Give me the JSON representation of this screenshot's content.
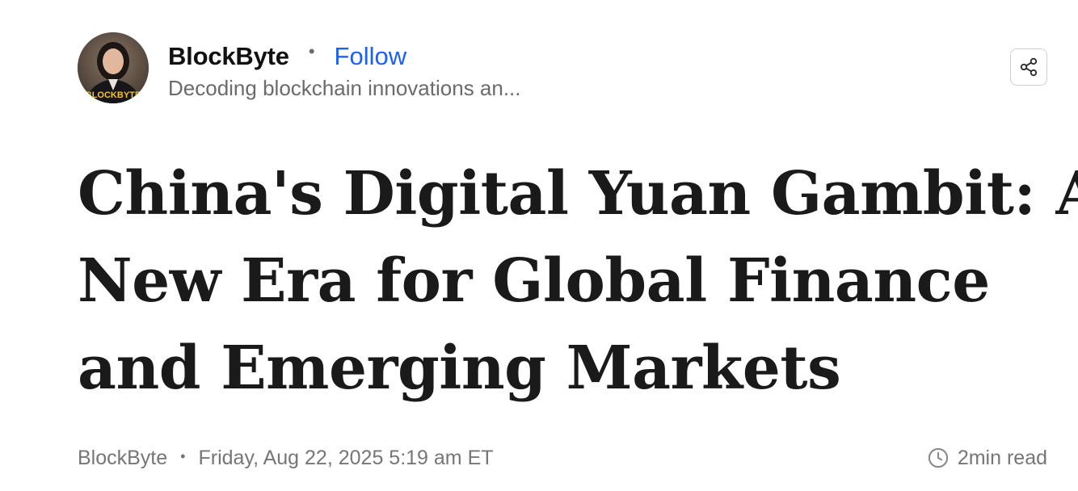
{
  "author": {
    "name": "BlockByte",
    "follow_label": "Follow",
    "tagline": "Decoding blockchain innovations an...",
    "avatar_badge_text": "BLOCKBYTE"
  },
  "icons": {
    "share": "share-icon",
    "clock": "clock-icon"
  },
  "article": {
    "headline_lines": [
      "China's Digital Yuan Gambit: A",
      "New Era for Global Finance",
      "and Emerging Markets"
    ]
  },
  "byline": {
    "source": "BlockByte",
    "separator": "•",
    "datetime": "Friday, Aug 22, 2025 5:19 am ET",
    "read_time": "2min read"
  },
  "colors": {
    "accent_link": "#1a5fff",
    "text_primary": "#1a1a1a",
    "text_muted": "#767676",
    "avatar_badge": "#f2c230"
  }
}
